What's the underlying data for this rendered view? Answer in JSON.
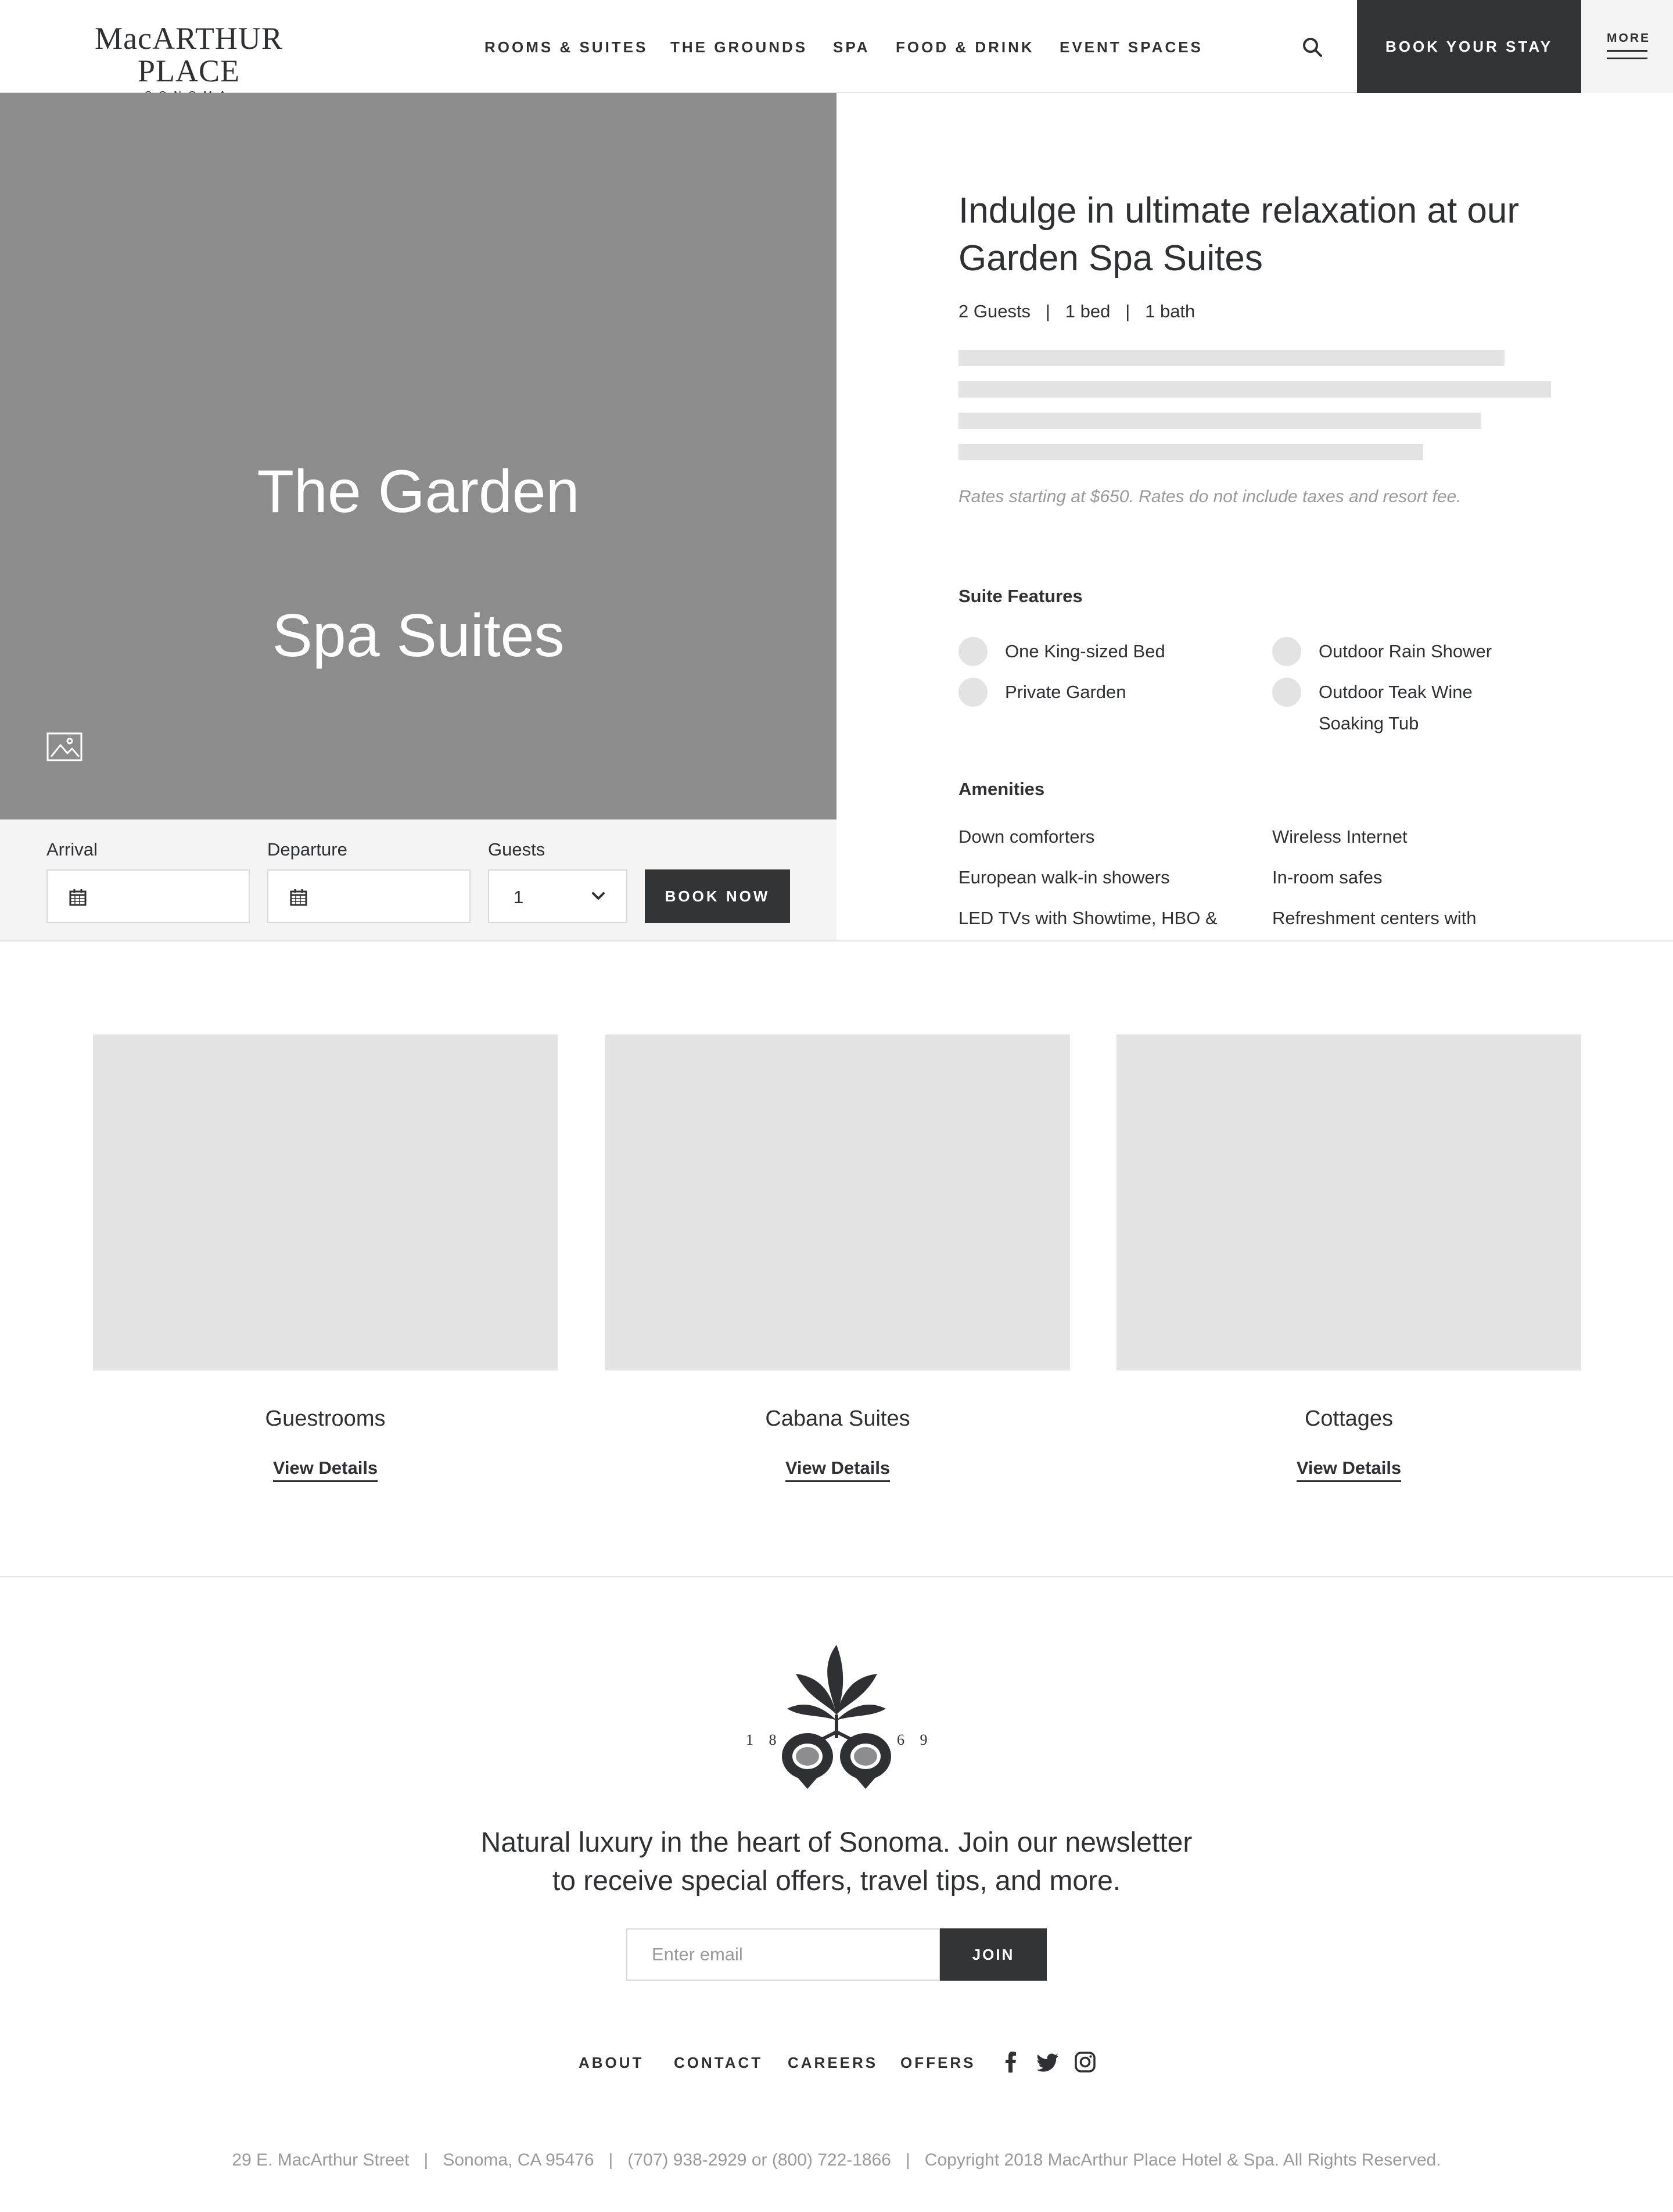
{
  "header": {
    "logo_main": "MacARTHUR PLACE",
    "logo_sub": "SONOMA",
    "nav": [
      "ROOMS & SUITES",
      "THE GROUNDS",
      "SPA",
      "FOOD & DRINK",
      "EVENT SPACES"
    ],
    "search_icon": "search-icon",
    "book_stay_label": "BOOK YOUR STAY",
    "more_label": "MORE",
    "more_icon": "hamburger-icon"
  },
  "hero": {
    "title_line1": "The Garden",
    "title_line2": "Spa Suites",
    "gallery_icon": "image-gallery-icon",
    "bg_color": "#8c8c8c"
  },
  "booking": {
    "arrival_label": "Arrival",
    "departure_label": "Departure",
    "guests_label": "Guests",
    "guests_value": "1",
    "calendar_icon": "calendar-icon",
    "dropdown_icon": "chevron-down-icon",
    "book_now_label": "BOOK NOW"
  },
  "details": {
    "title": "Indulge in ultimate relaxation at our Garden Spa Suites",
    "meta": "2 Guests   |   1 bed   |   1 bath",
    "rates": "Rates starting at $650. Rates do not include taxes and resort fee.",
    "features_heading": "Suite Features",
    "features": [
      "One King-sized Bed",
      "Private Garden",
      "Outdoor Rain Shower",
      "Outdoor Teak Wine",
      "Soaking Tub"
    ],
    "amenities_heading": "Amenities",
    "amenities": [
      "Down comforters",
      "European walk-in showers",
      "LED TVs with Showtime, HBO &",
      "Wireless Internet",
      "In-room safes",
      "Refreshment centers with"
    ]
  },
  "cards": [
    {
      "title": "Guestrooms",
      "link": "View Details"
    },
    {
      "title": "Cabana Suites",
      "link": "View Details"
    },
    {
      "title": "Cottages",
      "link": "View Details"
    }
  ],
  "footer": {
    "emblem_left": "1 8",
    "emblem_right": "6 9",
    "newsletter_line1": "Natural luxury in the heart of Sonoma. Join our newsletter",
    "newsletter_line2": "to receive special offers, travel tips, and more.",
    "email_placeholder": "Enter email",
    "join_label": "JOIN",
    "links": [
      "ABOUT",
      "CONTACT",
      "CAREERS",
      "OFFERS"
    ],
    "social_icons": [
      "facebook-icon",
      "twitter-icon",
      "instagram-icon"
    ],
    "address": "29 E. MacArthur Street   |   Sonoma, CA 95476   |   (707) 938-2929 or (800) 722-1866   |   Copyright 2018 MacArthur Place Hotel & Spa. All Rights Reserved."
  },
  "colors": {
    "dark": "#333436",
    "text": "#2f3033",
    "muted": "#9a9a9a",
    "placeholder_block": "#e3e3e3",
    "panel": "#f4f4f4"
  }
}
